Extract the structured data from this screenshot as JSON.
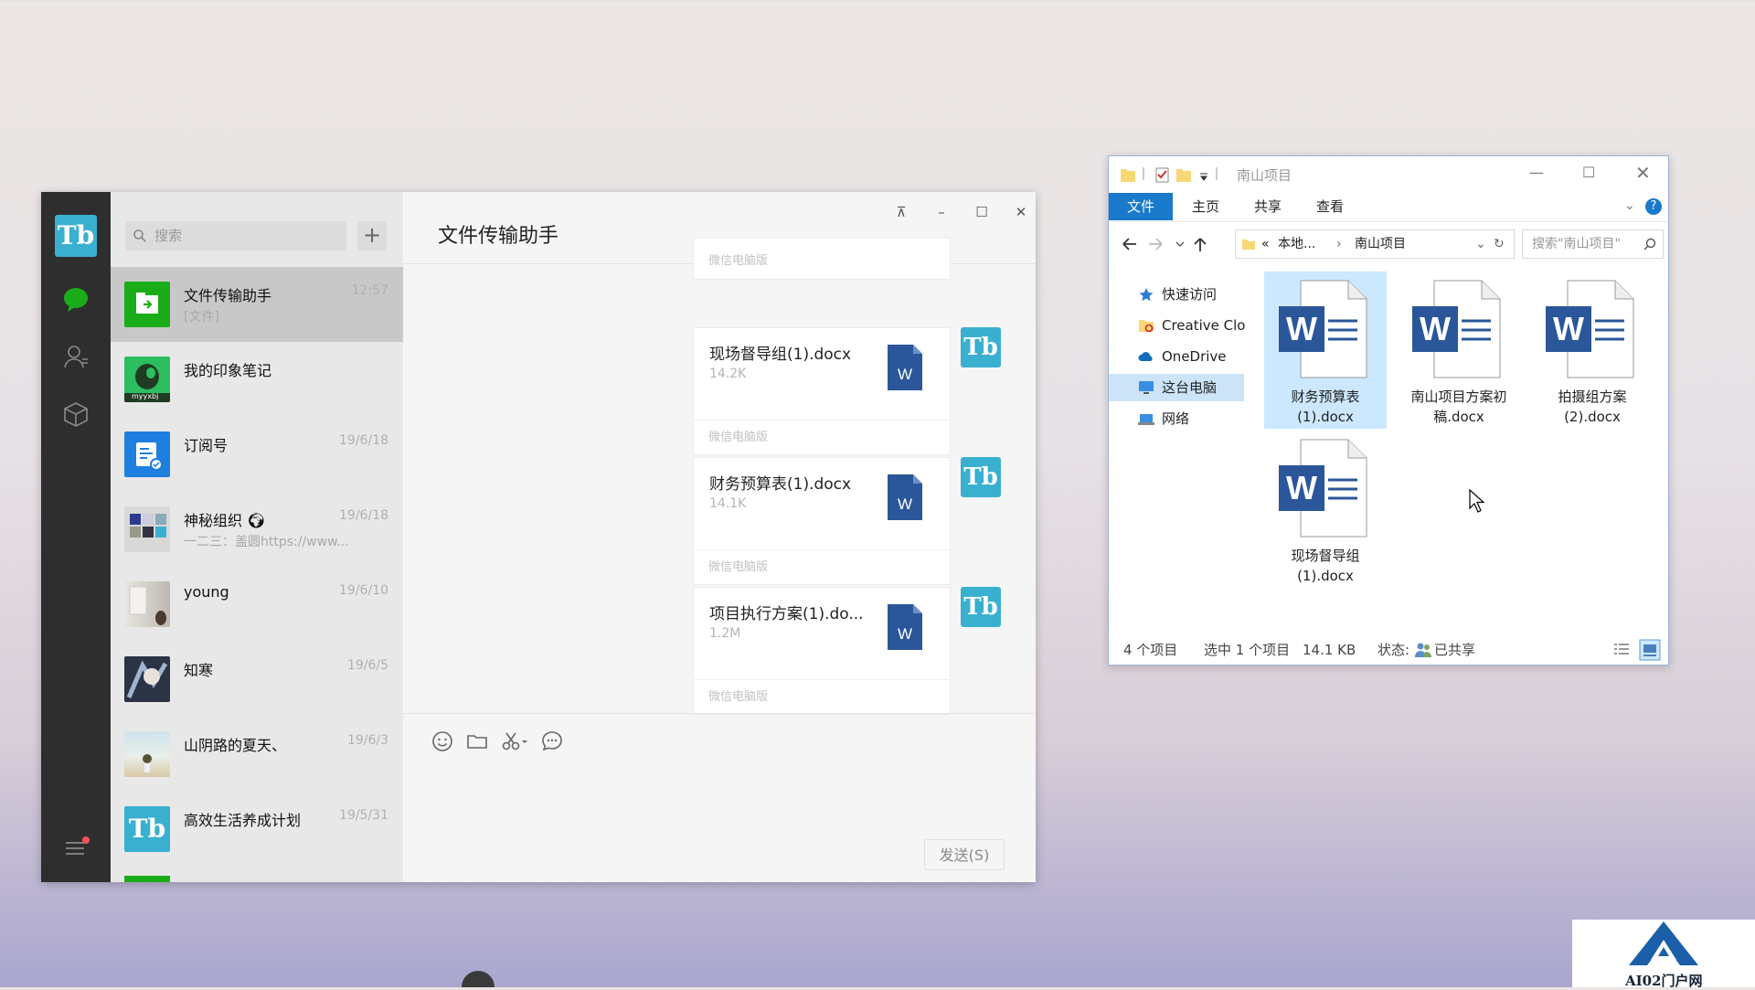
{
  "wechat": {
    "search_placeholder": "搜索",
    "add_label": "+",
    "avatar_text": "Tb",
    "chats": [
      {
        "name": "文件传输助手",
        "time": "12:57",
        "sub": "[文件]"
      },
      {
        "name": "我的印象笔记",
        "time": "",
        "sub": "",
        "thumb_text": "myyxbj"
      },
      {
        "name": "订阅号",
        "time": "19/6/18",
        "sub": ""
      },
      {
        "name": "神秘组织",
        "time": "19/6/18",
        "sub": "一二三：盖圆https://www..."
      },
      {
        "name": "young",
        "time": "19/6/10",
        "sub": ""
      },
      {
        "name": "知寒",
        "time": "19/6/5",
        "sub": ""
      },
      {
        "name": "山阴路的夏天、",
        "time": "19/6/3",
        "sub": ""
      },
      {
        "name": "高效生活养成计划",
        "time": "19/5/31",
        "sub": ""
      }
    ],
    "title": "文件传输助手",
    "window_buttons": {
      "pin": "⊼",
      "min": "–",
      "max": "☐",
      "close": "✕"
    },
    "source_label": "微信电脑版",
    "messages": [
      {
        "file": "现场督导组(1).docx",
        "size": "14.2K",
        "source": "微信电脑版"
      },
      {
        "file": "财务预算表(1).docx",
        "size": "14.1K",
        "source": "微信电脑版"
      },
      {
        "file": "项目执行方案(1).do...",
        "size": "1.2M",
        "source": "微信电脑版"
      }
    ],
    "send_label": "发送(S)"
  },
  "explorer": {
    "title": "南山项目",
    "tabs": [
      "文件",
      "主页",
      "共享",
      "查看"
    ],
    "address": {
      "root": "本地...",
      "folder": "南山项目"
    },
    "search_placeholder": "搜索\"南山项目\"",
    "sidebar": [
      "快速访问",
      "Creative Clo",
      "OneDrive",
      "这台电脑",
      "网络"
    ],
    "files": [
      {
        "line1": "财务预算表",
        "line2": "(1).docx"
      },
      {
        "line1": "南山项目方案初",
        "line2": "稿.docx"
      },
      {
        "line1": "拍摄组方案",
        "line2": "(2).docx"
      },
      {
        "line1": "现场督导组",
        "line2": "(1).docx"
      }
    ],
    "status": {
      "count": "4 个项目",
      "selected": "选中 1 个项目",
      "size": "14.1 KB",
      "state_label": "状态:",
      "state_value": "已共享"
    }
  },
  "watermark": {
    "text": "AI02门户网"
  },
  "colors": {
    "wechat_green": "#1aad19",
    "tb_blue": "#3ab0d0",
    "explorer_accent": "#1979ca",
    "word_blue": "#2b579a"
  }
}
